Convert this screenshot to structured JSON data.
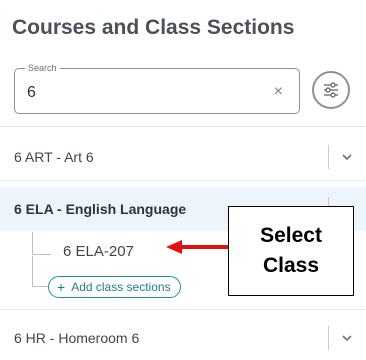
{
  "panel": {
    "title": "Courses and Class Sections"
  },
  "search": {
    "legend": "Search",
    "value": "6",
    "clear_glyph": "×"
  },
  "icons": {
    "filter": "sliders-icon",
    "chevron": "chevron-down-icon",
    "clear": "close-icon",
    "add": "plus-icon"
  },
  "courses": [
    {
      "label": "6 ART - Art 6"
    },
    {
      "label": "6 ELA - English Language"
    },
    {
      "label": "6 HR - Homeroom 6"
    }
  ],
  "sections": [
    {
      "label": "6 ELA-207"
    }
  ],
  "add_sections": {
    "plus": "+",
    "label": "Add class sections"
  },
  "annotation": {
    "line1": "Select",
    "line2": "Class"
  },
  "colors": {
    "accent": "#1e8fa3",
    "selected_bg": "#edf4fb",
    "arrow": "#e01010"
  }
}
